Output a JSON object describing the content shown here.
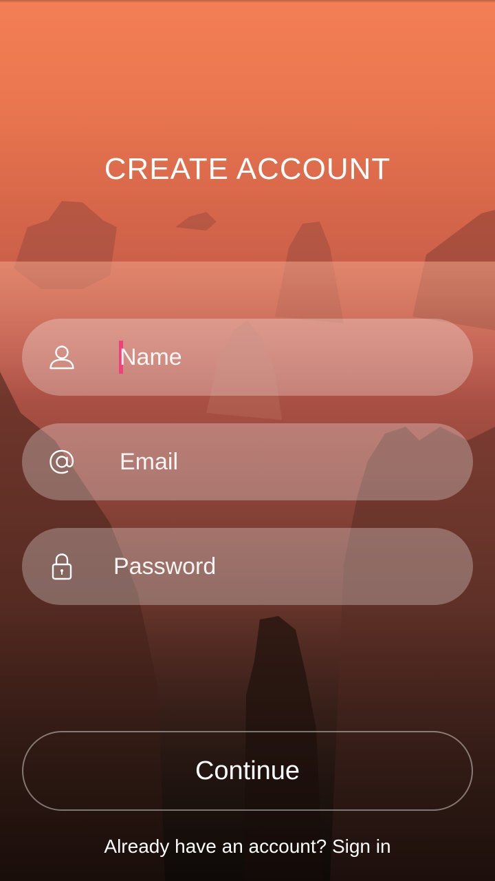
{
  "title": "CREATE ACCOUNT",
  "form": {
    "name": {
      "placeholder": "Name",
      "icon": "user-icon"
    },
    "email": {
      "placeholder": "Email",
      "icon": "at-sign-icon"
    },
    "password": {
      "placeholder": "Password",
      "icon": "lock-icon"
    }
  },
  "actions": {
    "continue_label": "Continue",
    "signin_text": "Already have an account? Sign in"
  },
  "colors": {
    "accent_caret": "#f0407e",
    "sky_top": "#f47f56",
    "ground_bottom": "#1f1610"
  }
}
